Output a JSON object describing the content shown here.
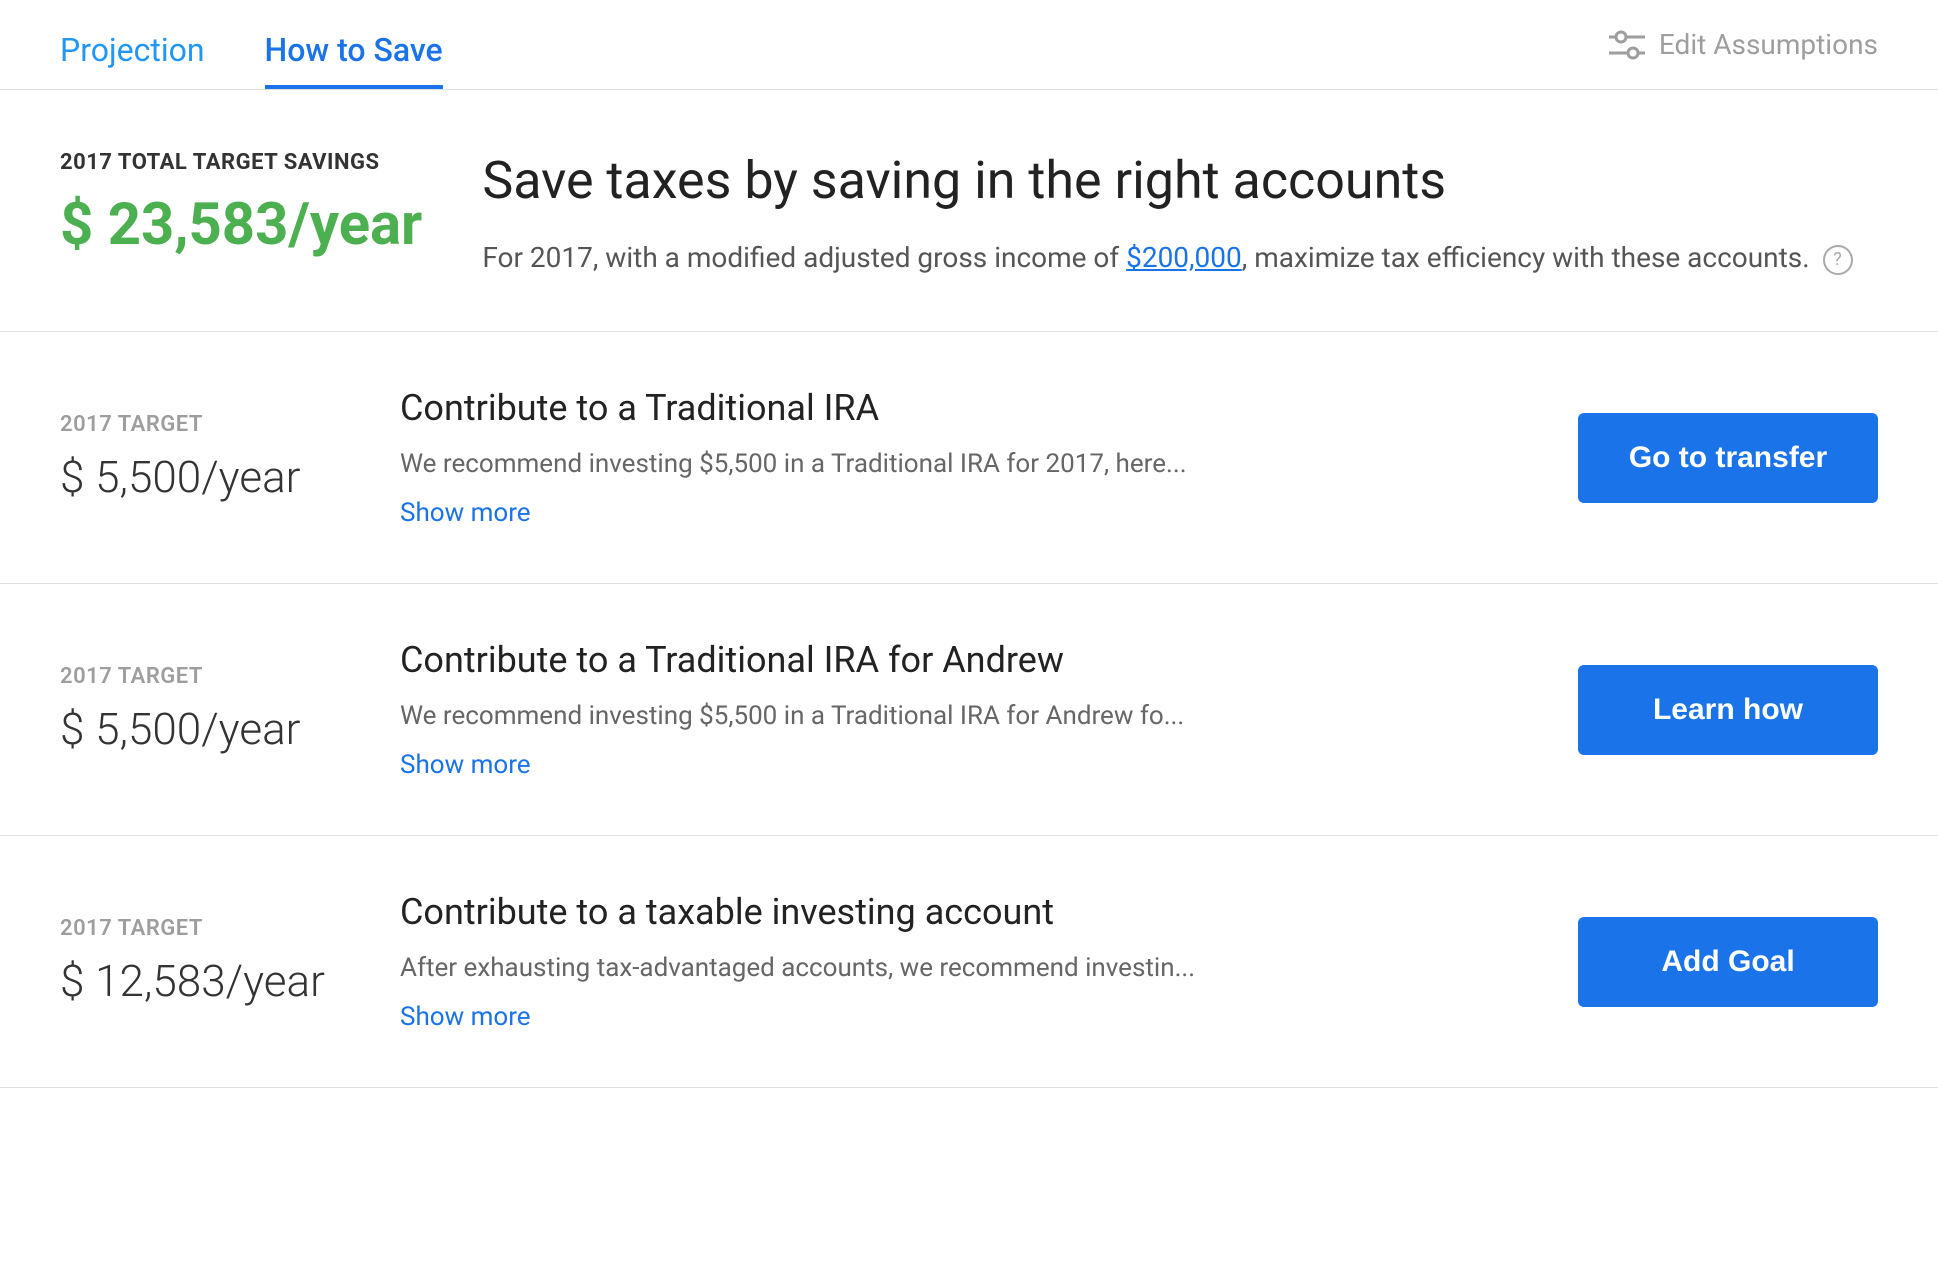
{
  "tabs": {
    "projection": {
      "label": "Projection",
      "active": false
    },
    "how_to_save": {
      "label": "How to Save",
      "active": true
    }
  },
  "header": {
    "edit_assumptions_label": "Edit Assumptions"
  },
  "hero": {
    "target_label": "2017 TOTAL TARGET SAVINGS",
    "amount": "$ 23,583/year",
    "title": "Save taxes by saving in the right accounts",
    "description_before": "For 2017, with a modified adjusted gross income of ",
    "income_link": "$200,000",
    "description_after": ", maximize tax efficiency with these accounts.",
    "info_icon": "?"
  },
  "accounts": [
    {
      "target_label": "2017 TARGET",
      "amount": "$ 5,500/year",
      "title": "Contribute to a Traditional IRA",
      "description": "We recommend investing $5,500 in a Traditional IRA for 2017, here...",
      "show_more": "Show more",
      "button_label": "Go to transfer"
    },
    {
      "target_label": "2017 TARGET",
      "amount": "$ 5,500/year",
      "title": "Contribute to a Traditional IRA for Andrew",
      "description": "We recommend investing $5,500 in a Traditional IRA for Andrew fo...",
      "show_more": "Show more",
      "button_label": "Learn how"
    },
    {
      "target_label": "2017 TARGET",
      "amount": "$ 12,583/year",
      "title": "Contribute to a taxable investing account",
      "description": "After exhausting tax-advantaged accounts, we recommend investin...",
      "show_more": "Show more",
      "button_label": "Add Goal"
    }
  ]
}
